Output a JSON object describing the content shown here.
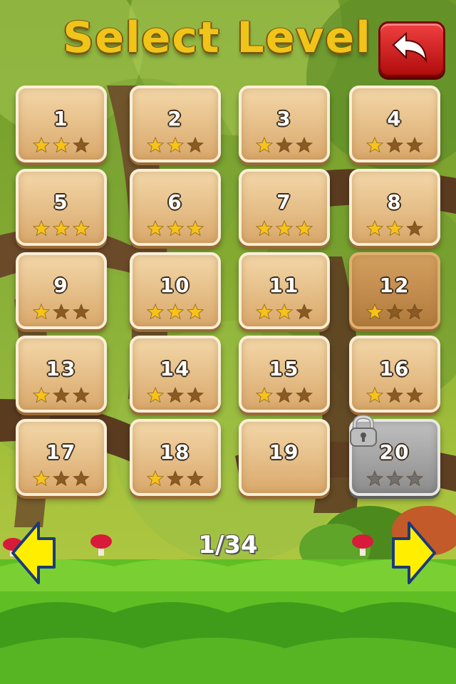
{
  "title": "Select Level",
  "pager": "1/34",
  "colors": {
    "star_on": "#f7c21a",
    "star_off": "#8b5a22",
    "star_locked": "#6f6f6f",
    "back_button": "#d71a1a",
    "arrows": "#ffee00"
  },
  "levels": [
    {
      "number": "1",
      "stars": 2,
      "state": "unlocked"
    },
    {
      "number": "2",
      "stars": 2,
      "state": "unlocked"
    },
    {
      "number": "3",
      "stars": 1,
      "state": "unlocked"
    },
    {
      "number": "4",
      "stars": 1,
      "state": "unlocked"
    },
    {
      "number": "5",
      "stars": 3,
      "state": "unlocked"
    },
    {
      "number": "6",
      "stars": 3,
      "state": "unlocked"
    },
    {
      "number": "7",
      "stars": 3,
      "state": "unlocked"
    },
    {
      "number": "8",
      "stars": 2,
      "state": "unlocked"
    },
    {
      "number": "9",
      "stars": 1,
      "state": "unlocked"
    },
    {
      "number": "10",
      "stars": 3,
      "state": "unlocked"
    },
    {
      "number": "11",
      "stars": 2,
      "state": "unlocked"
    },
    {
      "number": "12",
      "stars": 1,
      "state": "selected"
    },
    {
      "number": "13",
      "stars": 1,
      "state": "unlocked"
    },
    {
      "number": "14",
      "stars": 1,
      "state": "unlocked"
    },
    {
      "number": "15",
      "stars": 1,
      "state": "unlocked"
    },
    {
      "number": "16",
      "stars": 1,
      "state": "unlocked"
    },
    {
      "number": "17",
      "stars": 1,
      "state": "unlocked"
    },
    {
      "number": "18",
      "stars": 1,
      "state": "unlocked"
    },
    {
      "number": "19",
      "stars": 0,
      "state": "unlocked"
    },
    {
      "number": "20",
      "stars": 0,
      "state": "locked"
    }
  ],
  "icons": {
    "back": "back-arrow-icon",
    "prev": "left-arrow-icon",
    "next": "right-arrow-icon",
    "lock": "padlock-icon"
  }
}
